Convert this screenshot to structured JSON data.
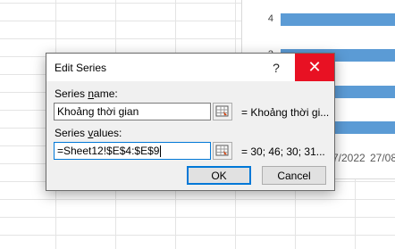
{
  "background": {
    "chart": {
      "tick_top": "4",
      "tick_second": "3",
      "x_labels": [
        "7/2022",
        "27/08"
      ],
      "bar_color": "#5b9bd5"
    }
  },
  "dialog": {
    "title": "Edit Series",
    "help_label": "?",
    "close_label": "✕",
    "series_name": {
      "label_prefix": "Series ",
      "label_accel": "n",
      "label_suffix": "ame:",
      "value": "Khoảng thời gian",
      "preview": "= Khoảng thời gi..."
    },
    "series_values": {
      "label_prefix": "Series ",
      "label_accel": "v",
      "label_suffix": "alues:",
      "value": "=Sheet12!$E$4:$E$9",
      "preview": "= 30; 46; 30; 31..."
    },
    "ok_label": "OK",
    "cancel_label": "Cancel",
    "colors": {
      "close_bg": "#e81123",
      "focus_border": "#0078d7"
    },
    "icons": {
      "range_selector": "range-selector-icon"
    }
  }
}
